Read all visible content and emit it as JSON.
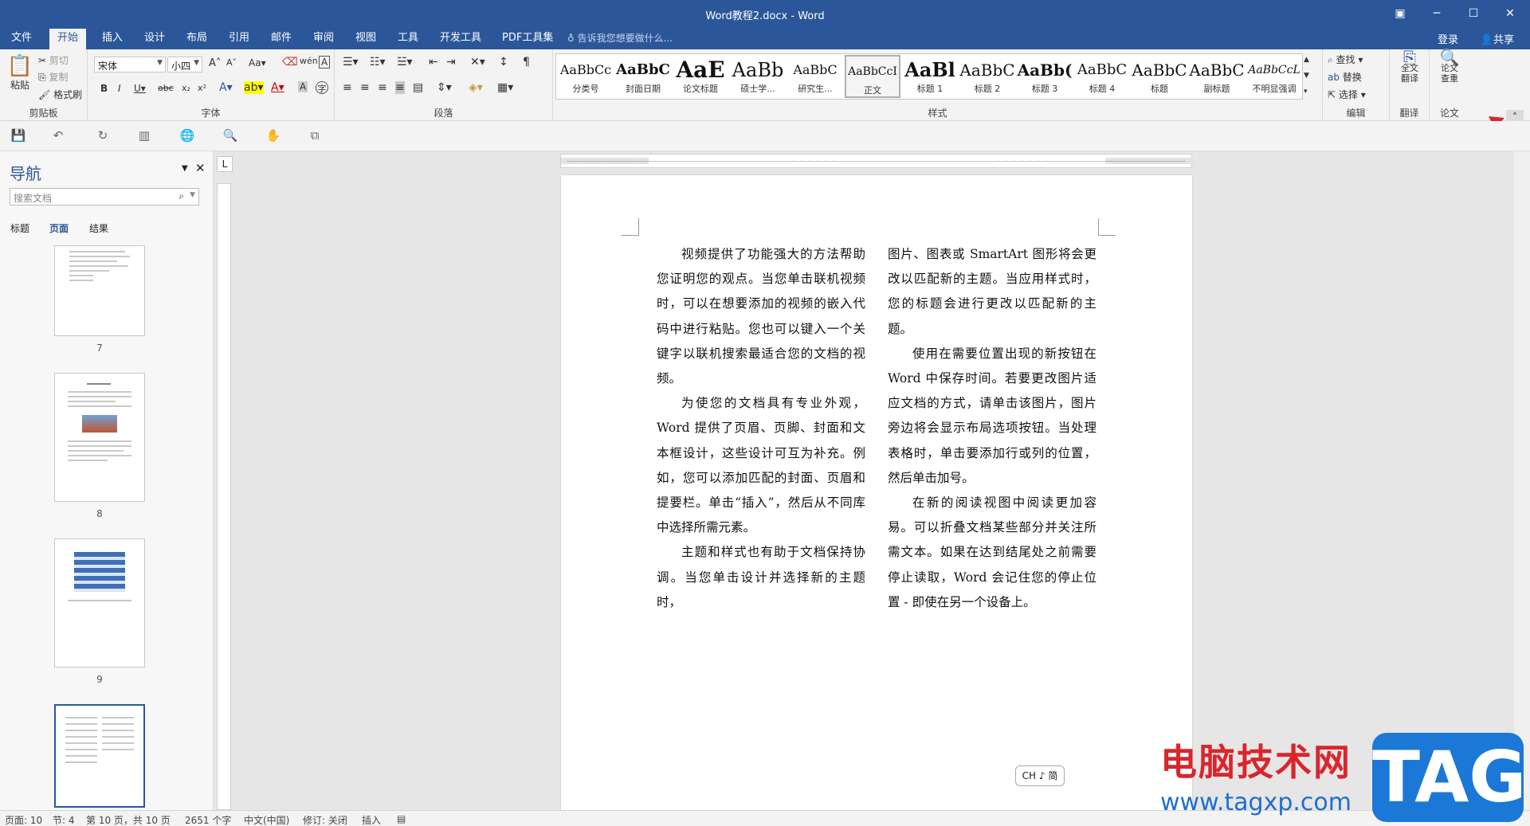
{
  "window": {
    "title": "Word教程2.docx - Word"
  },
  "tabs": [
    "文件",
    "开始",
    "插入",
    "设计",
    "布局",
    "引用",
    "邮件",
    "审阅",
    "视图",
    "工具",
    "开发工具",
    "PDF工具集"
  ],
  "tell_me": "告诉我您想要做什么...",
  "login": "登录",
  "share": "共享",
  "clipboard": {
    "paste": "粘贴",
    "cut": "剪切",
    "copy": "复制",
    "format_painter": "格式刷",
    "label": "剪贴板"
  },
  "font": {
    "name": "宋体",
    "size": "小四",
    "label": "字体"
  },
  "paragraph": {
    "label": "段落"
  },
  "styles": {
    "label": "样式",
    "items": [
      {
        "preview": "AaBbCc",
        "name": "分类号"
      },
      {
        "preview": "AaBbC",
        "name": "封面日期"
      },
      {
        "preview": "AaE",
        "name": "论文标题"
      },
      {
        "preview": "AaBb",
        "name": "硕士学..."
      },
      {
        "preview": "AaBbC",
        "name": "研究生..."
      },
      {
        "preview": "AaBbCcI",
        "name": "正文"
      },
      {
        "preview": "AaBl",
        "name": "标题 1"
      },
      {
        "preview": "AaBbC",
        "name": "标题 2"
      },
      {
        "preview": "AaBb(",
        "name": "标题 3"
      },
      {
        "preview": "AaBbC",
        "name": "标题 4"
      },
      {
        "preview": "AaBbC",
        "name": "标题"
      },
      {
        "preview": "AaBbC",
        "name": "副标题"
      },
      {
        "preview": "AaBbCcL",
        "name": "不明显强调"
      }
    ]
  },
  "editing": {
    "find": "查找",
    "replace": "替换",
    "select": "选择",
    "label": "编辑"
  },
  "translate": {
    "full": "全文\n翻译",
    "label": "翻译"
  },
  "thesis": {
    "check": "论文\n查重",
    "label": "论文"
  },
  "nav": {
    "title": "导航",
    "search_placeholder": "搜索文档",
    "tabs": [
      "标题",
      "页面",
      "结果"
    ],
    "pages": [
      "7",
      "8",
      "9"
    ]
  },
  "document": {
    "col1": [
      "视频提供了功能强大的方法帮助您证明您的观点。当您单击联机视频时，可以在想要添加的视频的嵌入代码中进行粘贴。您也可以键入一个关键字以联机搜索最适合您的文档的视频。",
      "为使您的文档具有专业外观，Word 提供了页眉、页脚、封面和文本框设计，这些设计可互为补充。例如，您可以添加匹配的封面、页眉和提要栏。单击“插入”，然后从不同库中选择所需元素。",
      "主题和样式也有助于文档保持协调。当您单击设计并选择新的主题时，"
    ],
    "col2_start": "图片、图表或 SmartArt 图形将会更改以匹配新的主题。当应用样式时，您的标题会进行更改以匹配新的主题。",
    "col2": [
      "使用在需要位置出现的新按钮在 Word 中保存时间。若要更改图片适应文档的方式，请单击该图片，图片旁边将会显示布局选项按钮。当处理表格时，单击要添加行或列的位置，然后单击加号。",
      "在新的阅读视图中阅读更加容易。可以折叠文档某些部分并关注所需文本。如果在达到结尾处之前需要停止读取，Word 会记住您的停止位置 - 即使在另一个设备上。"
    ]
  },
  "ime": "CH ♪ 简",
  "status": {
    "page": "页面: 10",
    "section": "节: 4",
    "page_of": "第 10 页，共 10 页",
    "words": "2651 个字",
    "lang": "中文(中国)",
    "track": "修订: 关闭",
    "insert": "插入"
  },
  "watermark": {
    "text": "电脑技术网",
    "url": "www.tagxp.com",
    "tag": "TAG"
  }
}
